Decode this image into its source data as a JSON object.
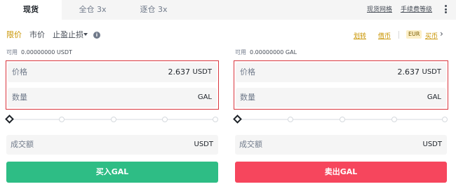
{
  "tabs": [
    {
      "label": "现货"
    },
    {
      "label": "全仓 3x"
    },
    {
      "label": "逐仓 3x"
    }
  ],
  "top_links": {
    "fee_link": "现货网格",
    "fee_level": "手续费等级"
  },
  "order_types": {
    "limit": "限价",
    "market": "市价",
    "stop": "止盈止损"
  },
  "right_links": {
    "link1": "划转",
    "link2": "借币",
    "currency": "EUR",
    "buy": "买币"
  },
  "buy": {
    "available_label": "可用",
    "available_value": "0.00000000 USDT",
    "price_label": "价格",
    "price_value": "2.637",
    "price_unit": "USDT",
    "qty_label": "数量",
    "qty_unit": "GAL",
    "total_label": "成交额",
    "total_unit": "USDT",
    "button_label": "买入GAL"
  },
  "sell": {
    "available_label": "可用",
    "available_value": "0.00000000 GAL",
    "price_label": "价格",
    "price_value": "2.637",
    "price_unit": "USDT",
    "qty_label": "数量",
    "qty_unit": "GAL",
    "total_label": "成交额",
    "total_unit": "USDT",
    "button_label": "卖出GAL"
  },
  "colors": {
    "accent": "#c99400",
    "buy": "#2ebd85",
    "sell": "#f6465d",
    "highlight_border": "#d9363e"
  },
  "icons": {
    "info": "info-icon",
    "more": "more-vertical-icon",
    "dropdown": "caret-down-icon",
    "chevron": "chevron-right-icon"
  }
}
